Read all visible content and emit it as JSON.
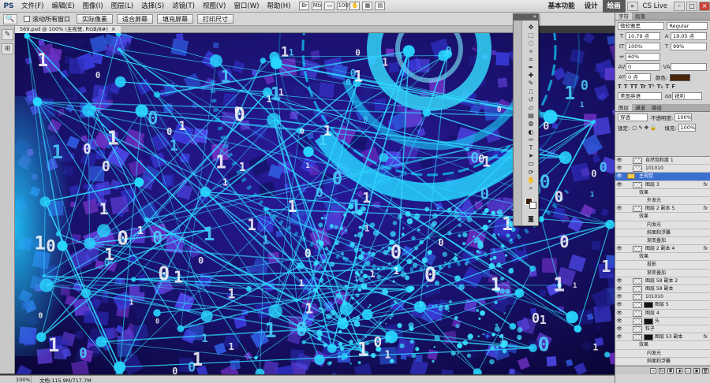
{
  "app": {
    "logo": "PS"
  },
  "menu": [
    "文件(F)",
    "编辑(E)",
    "图像(I)",
    "图层(L)",
    "选择(S)",
    "滤镜(T)",
    "视图(V)",
    "窗口(W)",
    "帮助(H)"
  ],
  "menu_icons": [
    "Br",
    "Mb",
    "▭",
    "100%",
    "✋",
    "▦",
    "▤"
  ],
  "workspace": {
    "items": [
      "基本功能",
      "设计",
      "绘画"
    ],
    "active_index": 2,
    "cs_live": "CS Live"
  },
  "options_bar": {
    "tool": "🔍",
    "checkbox_label": "滚动所有窗口",
    "buttons": [
      "实际像素",
      "适合屏幕",
      "填充屏幕",
      "打印尺寸"
    ]
  },
  "document": {
    "tab_title": "569.psd @ 100% (主视觉, RGB/8#)",
    "close": "×"
  },
  "status": {
    "zoom": "100%",
    "doc_size": "文档:115.9M/717.7M"
  },
  "character_panel": {
    "tabs": [
      "字符",
      "段落"
    ],
    "font_family": "微软雅黑",
    "font_style": "Regular",
    "font_size": "10.79 点",
    "leading": "19.05 点",
    "vscale": "100%",
    "hscale": "99%",
    "tracking": "60%",
    "kerning": "0",
    "baseline": "0 点",
    "color_label": "颜色:",
    "text_color": "#4a2408",
    "glyphs": [
      "T",
      "T",
      "TT",
      "Tr",
      "T¹",
      "T₁",
      "T",
      "F"
    ],
    "language": "美国英语",
    "antialias": "锐利"
  },
  "layers_panel": {
    "tabs": [
      "图层",
      "通道",
      "路径"
    ],
    "blend_mode": "穿透",
    "opacity_label": "不透明度:",
    "opacity": "100%",
    "lock_label": "锁定:",
    "fill_label": "填充:",
    "fill": "100%",
    "layers": [
      {
        "name": "自然饱和度 1",
        "type": "adjust"
      },
      {
        "name": "101010",
        "type": "layer"
      },
      {
        "name": "主视觉",
        "type": "group",
        "selected": true
      },
      {
        "name": "图层 3",
        "type": "layer",
        "fx": "fx"
      },
      {
        "name": "效果",
        "type": "effect"
      },
      {
        "name": "外发光",
        "type": "effect2"
      },
      {
        "name": "图层 2 副本 5",
        "type": "layer",
        "fx": "fx"
      },
      {
        "name": "效果",
        "type": "effect"
      },
      {
        "name": "内发光",
        "type": "effect2"
      },
      {
        "name": "斜面和浮雕",
        "type": "effect2"
      },
      {
        "name": "渐变叠加",
        "type": "effect2"
      },
      {
        "name": "图层 2 副本 4",
        "type": "layer",
        "fx": "fx"
      },
      {
        "name": "效果",
        "type": "effect"
      },
      {
        "name": "投影",
        "type": "effect2"
      },
      {
        "name": "渐变叠加",
        "type": "effect2"
      },
      {
        "name": "图层 58 副本 2",
        "type": "layer"
      },
      {
        "name": "图层 58 副本",
        "type": "layer"
      },
      {
        "name": "101010",
        "type": "layer"
      },
      {
        "name": "图层 5",
        "type": "masked"
      },
      {
        "name": "图层 4",
        "type": "layer"
      },
      {
        "name": "头",
        "type": "masked"
      },
      {
        "name": "粒子",
        "type": "layer"
      },
      {
        "name": "图层 53 副本",
        "type": "masked",
        "fx": "fx"
      },
      {
        "name": "效果",
        "type": "effect"
      },
      {
        "name": "内发光",
        "type": "effect2"
      },
      {
        "name": "斜面和浮雕",
        "type": "effect2"
      },
      {
        "name": "渐变叠加",
        "type": "effect2"
      },
      {
        "name": "头 副本 2",
        "type": "layer"
      }
    ]
  },
  "colors": {
    "foreground": "#3a1b08",
    "background": "#ffffff",
    "selection": "#3a6fd0",
    "canvas_bg": "#0b0533"
  }
}
